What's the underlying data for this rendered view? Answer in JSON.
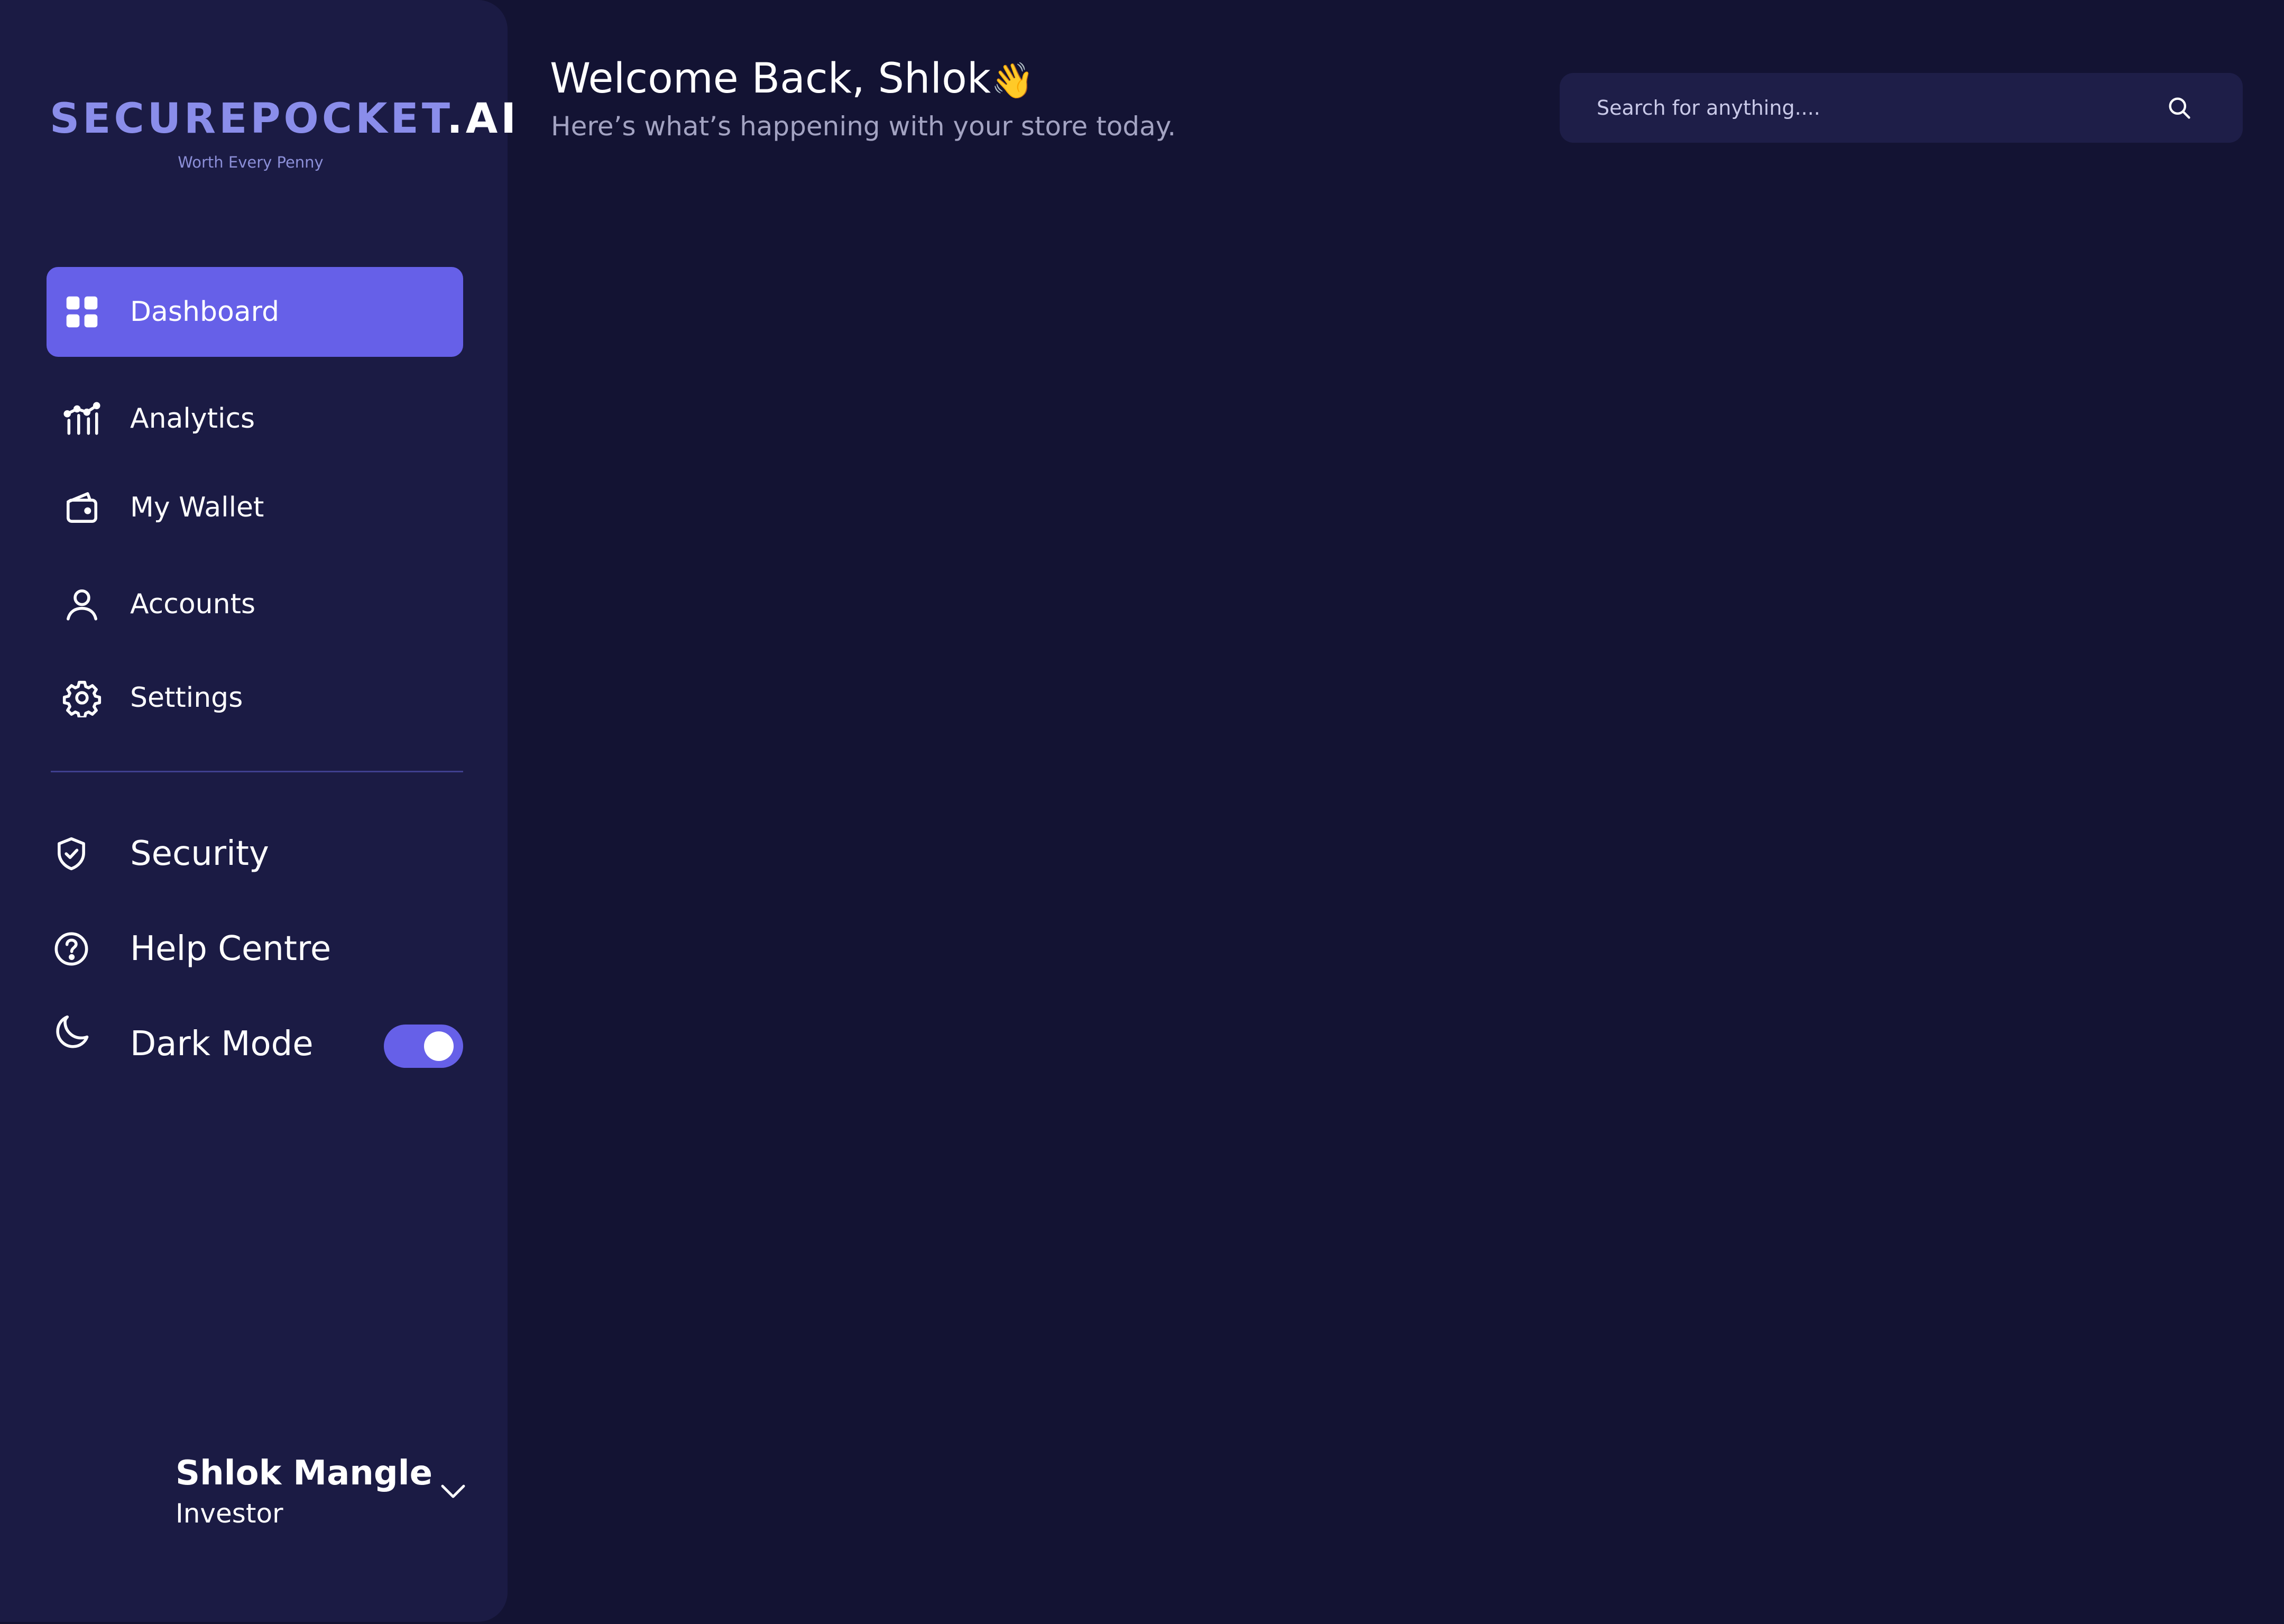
{
  "brand": {
    "logo_part1": "SECUREPOCKET",
    "logo_part2": ".AI",
    "tagline": "Worth Every Penny",
    "accent_color": "#6660e8"
  },
  "sidebar": {
    "nav": [
      {
        "label": "Dashboard",
        "icon": "grid-icon",
        "active": true
      },
      {
        "label": "Analytics",
        "icon": "analytics-icon"
      },
      {
        "label": "My Wallet",
        "icon": "wallet-icon"
      },
      {
        "label": "Accounts",
        "icon": "user-icon"
      },
      {
        "label": "Settings",
        "icon": "gear-icon"
      }
    ],
    "secondary": [
      {
        "label": "Security",
        "icon": "shield-icon"
      },
      {
        "label": "Help Centre",
        "icon": "help-icon"
      },
      {
        "label": "Dark Mode",
        "icon": "moon-icon",
        "toggle_on": true
      }
    ]
  },
  "user": {
    "name": "Shlok Mangle",
    "role": "Investor"
  },
  "header": {
    "welcome": "Welcome Back, Shlok",
    "wave_emoji": "👋",
    "subtitle": "Here’s what’s happening with your store today."
  },
  "search": {
    "placeholder": "Search for anything...."
  }
}
